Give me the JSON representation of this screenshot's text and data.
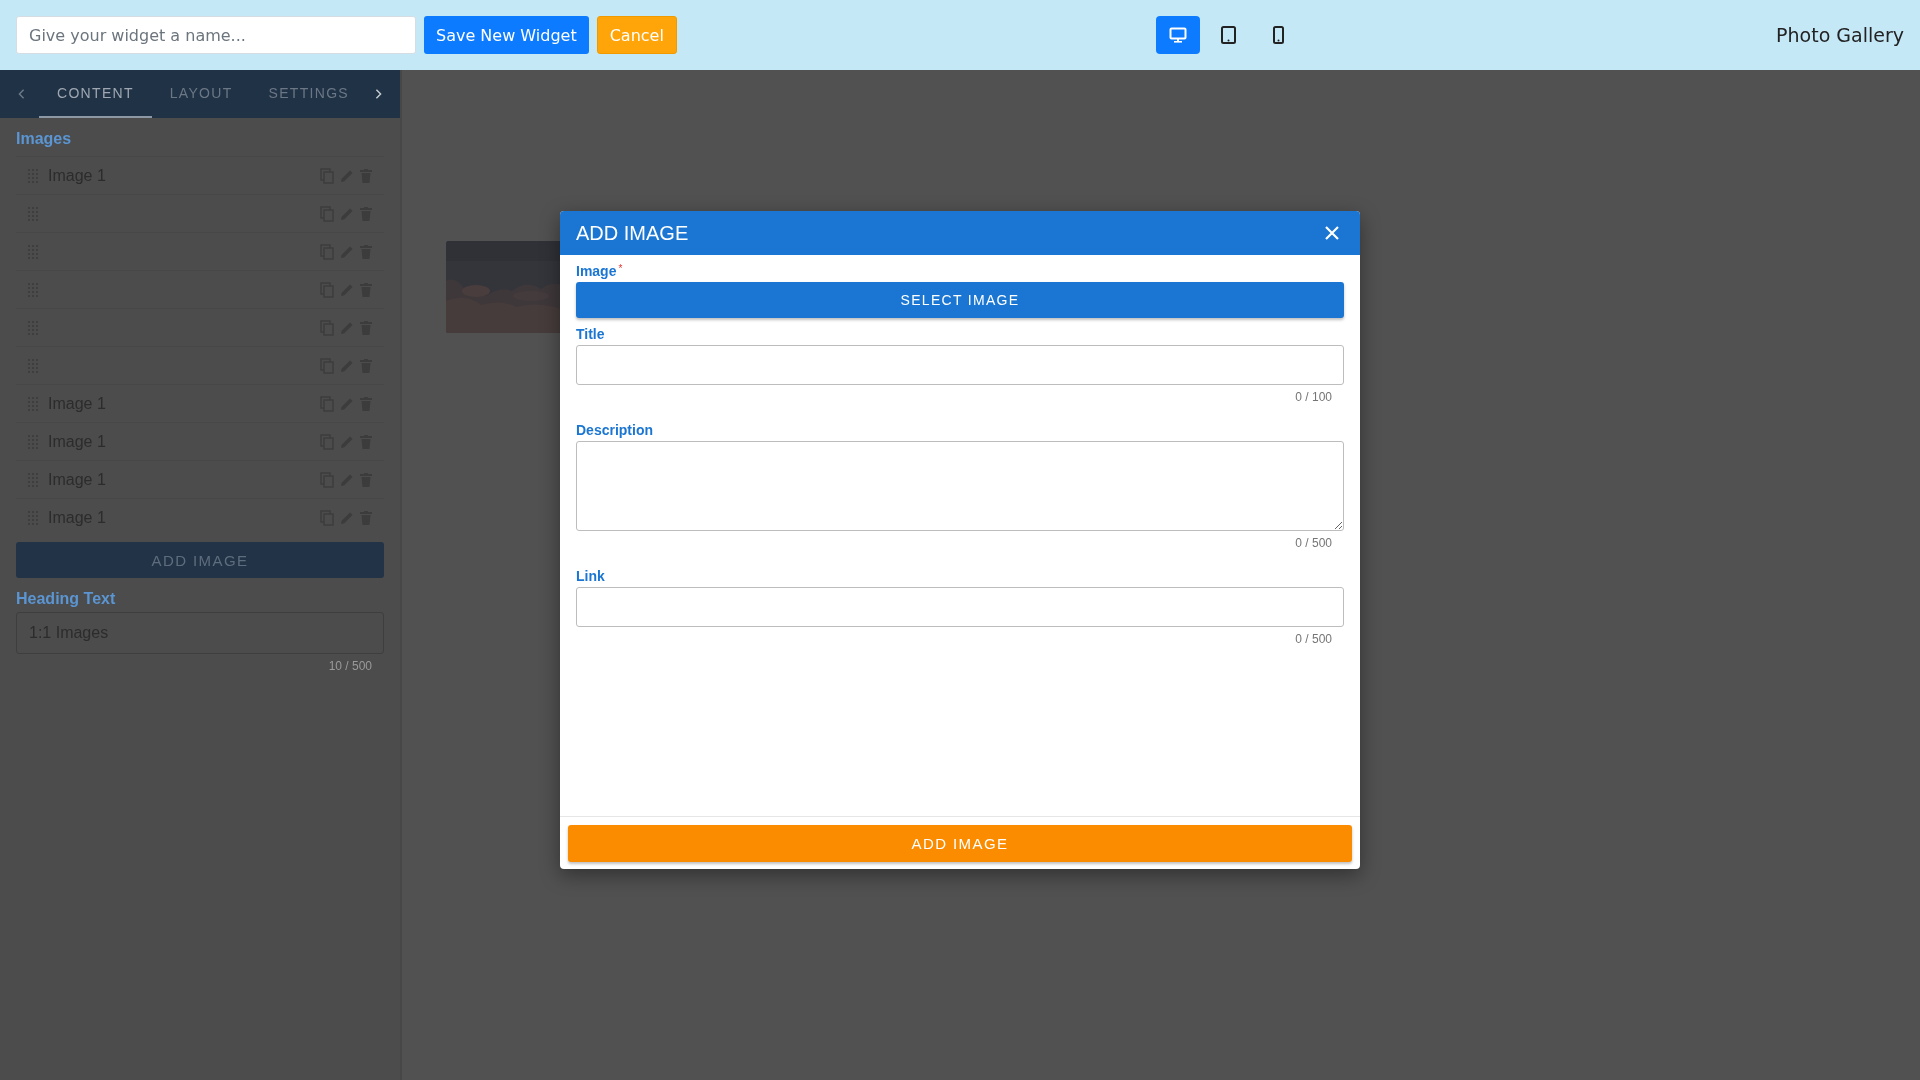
{
  "top_bar": {
    "name_field": {
      "placeholder": "Give your widget a name..."
    },
    "buttons": [
      {
        "label": "Save New Widget",
        "kind": "primary"
      },
      {
        "label": "Cancel",
        "kind": "warning"
      }
    ],
    "devices": [
      {
        "kind": "desktop",
        "selected": true
      },
      {
        "kind": "tablet",
        "selected": false
      },
      {
        "kind": "phone",
        "selected": false
      }
    ],
    "title": "Photo Gallery"
  },
  "sidebar": {
    "tabs": [
      {
        "label": "CONTENT",
        "selected": true
      },
      {
        "label": "LAYOUT",
        "selected": false
      },
      {
        "label": "SETTINGS",
        "selected": false
      }
    ],
    "images_label": "Images",
    "items": [
      {
        "kind": "named",
        "label": "Image 1"
      },
      {
        "kind": "blank"
      },
      {
        "kind": "blank"
      },
      {
        "kind": "blank"
      },
      {
        "kind": "blank"
      },
      {
        "kind": "blank"
      },
      {
        "kind": "named",
        "label": "Image 1"
      },
      {
        "kind": "named",
        "label": "Image 1"
      },
      {
        "kind": "named",
        "label": "Image 1"
      },
      {
        "kind": "named",
        "label": "Image 1"
      }
    ],
    "add_button": "ADD IMAGE",
    "heading_label": "Heading Text",
    "heading_field": {
      "value": "1:1 Images",
      "counter": "10 / 500"
    }
  },
  "modal": {
    "title": "ADD IMAGE",
    "fields": [
      {
        "kind": "button",
        "label": "Image",
        "required_mark": "*",
        "button": "SELECT IMAGE"
      },
      {
        "kind": "input",
        "label": "Title",
        "counter": "0 / 100"
      },
      {
        "kind": "textarea",
        "label": "Description",
        "counter": "0 / 500"
      },
      {
        "kind": "input",
        "label": "Link",
        "counter": "0 / 500"
      }
    ],
    "submit": "ADD IMAGE"
  }
}
